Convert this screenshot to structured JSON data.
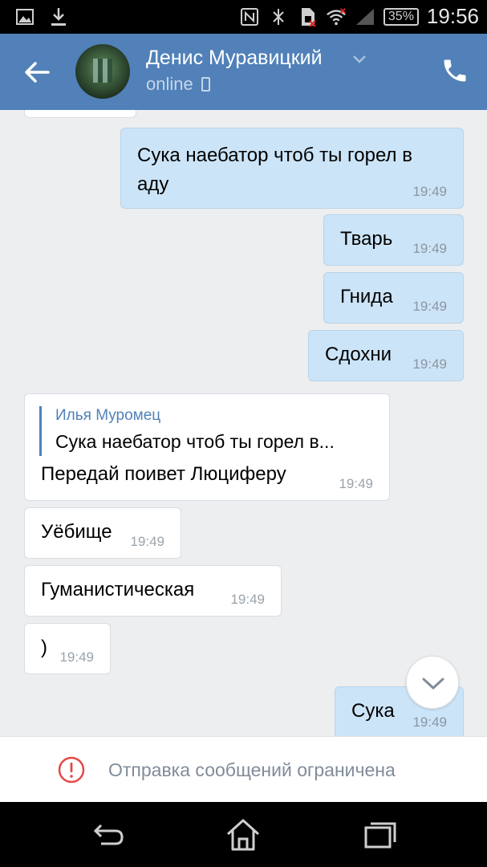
{
  "status_bar": {
    "icons": [
      "image-notification-icon",
      "download-icon",
      "nfc-icon",
      "bluetooth-icon",
      "sim-icon",
      "wifi-icon",
      "signal-icon"
    ],
    "battery": "35%",
    "time": "19:56"
  },
  "header": {
    "contact_name": "Денис Муравицкий",
    "status": "online",
    "accent_color": "#5181b8"
  },
  "messages": [
    {
      "direction": "out",
      "text_lines": [
        "Сука наебатор чтоб ты горел в",
        "аду"
      ],
      "time": "19:49"
    },
    {
      "direction": "out",
      "text": "Тварь",
      "time": "19:49"
    },
    {
      "direction": "out",
      "text": "Гнида",
      "time": "19:49"
    },
    {
      "direction": "out",
      "text": "Сдохни",
      "time": "19:49"
    },
    {
      "direction": "in",
      "reply": {
        "author": "Илья Муромец",
        "text": "Сука наебатор чтоб ты горел в..."
      },
      "text": "Передай поивет Люциферу",
      "time": "19:49"
    },
    {
      "direction": "in",
      "text": "Уёбище",
      "time": "19:49"
    },
    {
      "direction": "in",
      "text": "Гуманистическая",
      "time": "19:49"
    },
    {
      "direction": "in",
      "text": ")",
      "time": "19:49"
    },
    {
      "direction": "out",
      "text": "Сука",
      "time": "19:49"
    }
  ],
  "restricted_notice": "Отправка сообщений ограничена",
  "nav": {
    "buttons": [
      "back-icon",
      "home-icon",
      "recents-icon"
    ]
  }
}
